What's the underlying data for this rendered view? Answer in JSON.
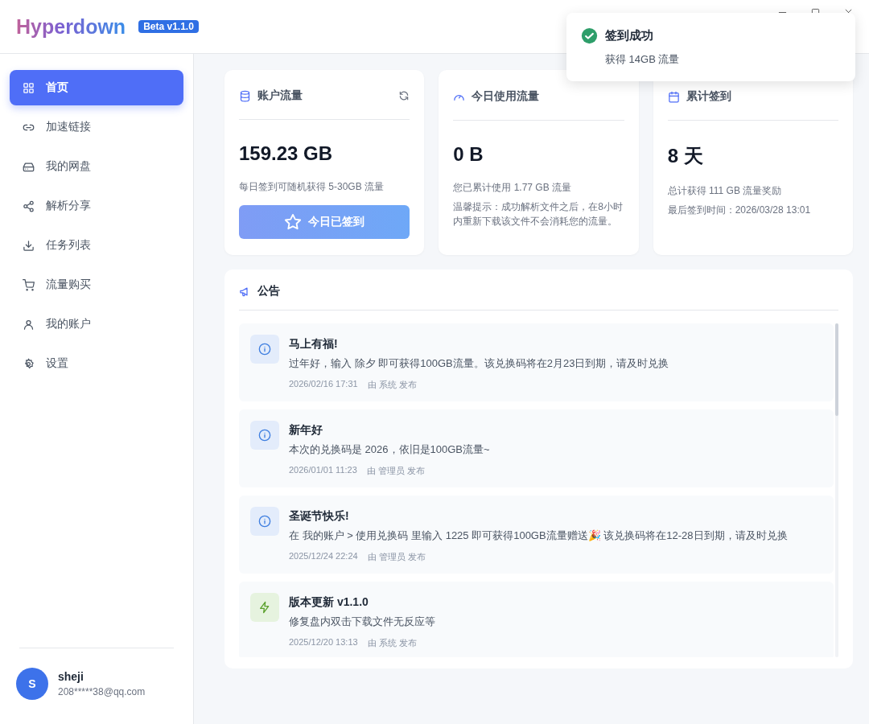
{
  "app": {
    "title": "Hyperdown",
    "badge": "Beta v1.1.0"
  },
  "nav": [
    {
      "label": "首页",
      "selected": true
    },
    {
      "label": "加速链接",
      "selected": false
    },
    {
      "label": "我的网盘",
      "selected": false
    },
    {
      "label": "解析分享",
      "selected": false
    },
    {
      "label": "任务列表",
      "selected": false
    },
    {
      "label": "流量购买",
      "selected": false
    },
    {
      "label": "我的账户",
      "selected": false
    },
    {
      "label": "设置",
      "selected": false
    }
  ],
  "user": {
    "avatar": "S",
    "name": "sheji",
    "email": "208*****38@qq.com"
  },
  "stat_cards": [
    {
      "kind": "balance",
      "title": "账户流量",
      "value": "159.23 GB",
      "lines": [
        "每日签到可随机获得 5-30GB 流量"
      ],
      "button": {
        "label": "今日已签到",
        "disabled": true
      }
    },
    {
      "kind": "usage",
      "title": "今日使用流量",
      "value": "0 B",
      "lines": [
        "您已累计使用 1.77 GB 流量",
        "温馨提示：成功解析文件之后，在8小时内重新下载该文件不会消耗您的流量。"
      ]
    },
    {
      "kind": "checkin",
      "title": "累计签到",
      "value": "8 天",
      "lines": [
        "总计获得 111 GB 流量奖励",
        "最后签到时间：2026/03/28 13:01"
      ]
    }
  ],
  "announcements": {
    "title": "公告",
    "items": [
      {
        "kind": "info",
        "title": "马上有福!",
        "body": "过年好，输入 除夕 即可获得100GB流量。该兑换码将在2月23日到期，请及时兑换",
        "date": "2026/02/16 17:31",
        "author": "由 系统 发布"
      },
      {
        "kind": "info",
        "title": "新年好",
        "body": "本次的兑换码是 2026，依旧是100GB流量~",
        "date": "2026/01/01 11:23",
        "author": "由 管理员 发布"
      },
      {
        "kind": "info",
        "title": "圣诞节快乐!",
        "body": "在 我的账户 > 使用兑换码 里输入 1225 即可获得100GB流量赠送🎉 该兑换码将在12-28日到期，请及时兑换",
        "date": "2025/12/24 22:24",
        "author": "由 管理员 发布"
      },
      {
        "kind": "update",
        "title": "版本更新 v1.1.0",
        "body": "修复盘内双击下载文件无反应等",
        "date": "2025/12/20 13:13",
        "author": "由 系统 发布"
      }
    ]
  },
  "toast": {
    "kind": "success",
    "title": "签到成功",
    "message": "获得 14GB 流量"
  }
}
